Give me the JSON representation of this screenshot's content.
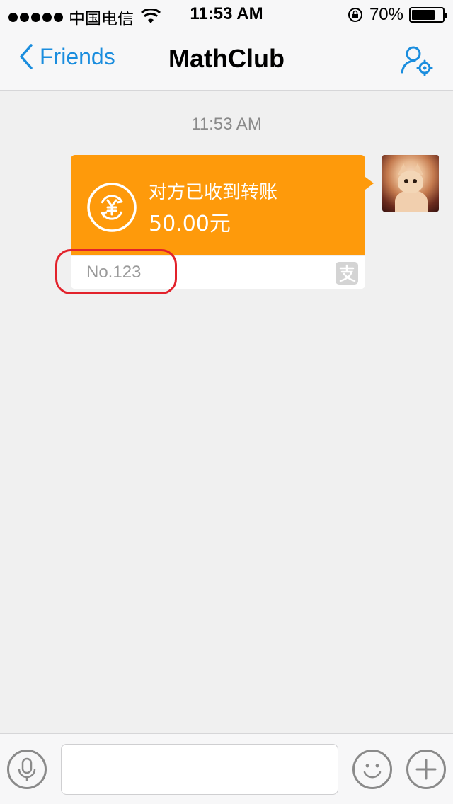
{
  "status_bar": {
    "carrier": "中国电信",
    "time": "11:53 AM",
    "battery": "70%",
    "battery_level": 0.7
  },
  "nav": {
    "back_label": "Friends",
    "title": "MathClub",
    "profile_settings_icon": "person-settings-icon"
  },
  "chat": {
    "timestamp": "11:53 AM",
    "message": {
      "status_text": "对方已收到转账",
      "amount": "50.00元",
      "note": "No.123",
      "transfer_icon": "yuan-transfer-icon",
      "payment_icon": "alipay-icon"
    }
  },
  "input_bar": {
    "voice_icon": "microphone-icon",
    "emoji_icon": "smiley-icon",
    "add_icon": "plus-icon",
    "text_value": ""
  },
  "colors": {
    "accent": "#1a8dde",
    "transfer_bubble": "#fe9a0b",
    "highlight": "#e2222b"
  }
}
